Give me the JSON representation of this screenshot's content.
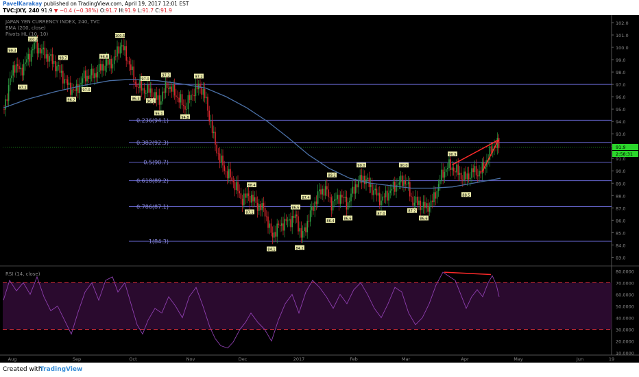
{
  "header": {
    "author": "PavelKarakay",
    "published": "published on TradingView.com, April 19, 2017 12:01 EST",
    "symbol": "TVC:JXY, 240",
    "last": "91.9",
    "change": "−0.4 (−0.38%)",
    "ohlc_o_label": "O:",
    "ohlc_o": "91.7",
    "ohlc_h_label": "H:",
    "ohlc_h": "91.9",
    "ohlc_l_label": "L:",
    "ohlc_l": "91.7",
    "ohlc_c_label": "C:",
    "ohlc_c": "91.9"
  },
  "footer": {
    "created": "Created with",
    "brand": "TradingView"
  },
  "colors": {
    "background": "#000000",
    "candle_up": "#2ea043",
    "candle_down": "#d9272e",
    "ema": "#4a6fa5",
    "fib": "#6a6ad6",
    "rsi_line": "#8e3fb0",
    "rsi_band": "#2a0a2e",
    "rsi_level": "#c62a3a",
    "trend": "#ff2a2a",
    "price_label": "#2bd62b"
  },
  "chart_data": {
    "type": "candlestick",
    "main_panel": {
      "legend": [
        "JAPAN YEN CURRENCY INDEX, 240, TVC",
        "EMA (200, close)",
        "Pivots HL (10, 10)"
      ],
      "y_ticks": [
        "102.0",
        "101.0",
        "100.0",
        "99.0",
        "98.0",
        "97.0",
        "96.0",
        "95.0",
        "94.0",
        "93.0",
        "92.0",
        "91.0",
        "90.0",
        "89.0",
        "88.0",
        "87.0",
        "86.0",
        "85.0",
        "84.0",
        "83.0"
      ],
      "ylim": [
        82.3,
        102.5
      ],
      "current_price": "91.9",
      "current_label2": "2:58:31",
      "fib_levels": [
        {
          "label": "",
          "value": 97.0
        },
        {
          "label": "0.236(94.1)",
          "value": 94.1
        },
        {
          "label": "0.382(92.3)",
          "value": 92.3
        },
        {
          "label": "0.5(90.7)",
          "value": 90.7
        },
        {
          "label": "0.618(89.2)",
          "value": 89.2
        },
        {
          "label": "0.786(87.1)",
          "value": 87.1
        },
        {
          "label": "1(84.3)",
          "value": 84.3
        }
      ],
      "pivot_labels": [
        {
          "t": 18,
          "text": "99.3",
          "v": 99.3,
          "pos": "above"
        },
        {
          "t": 33,
          "text": "97.2",
          "v": 97.2,
          "pos": "below"
        },
        {
          "t": 48,
          "text": "100.2",
          "v": 100.2,
          "pos": "above"
        },
        {
          "t": 92,
          "text": "98.7",
          "v": 98.7,
          "pos": "above"
        },
        {
          "t": 104,
          "text": "96.2",
          "v": 96.2,
          "pos": "below"
        },
        {
          "t": 126,
          "text": "97.0",
          "v": 97.0,
          "pos": "below"
        },
        {
          "t": 152,
          "text": "98.8",
          "v": 98.8,
          "pos": "above"
        },
        {
          "t": 175,
          "text": "100.5",
          "v": 100.5,
          "pos": "above"
        },
        {
          "t": 198,
          "text": "96.3",
          "v": 96.3,
          "pos": "below"
        },
        {
          "t": 212,
          "text": "97.0",
          "v": 97.0,
          "pos": "above"
        },
        {
          "t": 220,
          "text": "96.1",
          "v": 96.1,
          "pos": "below"
        },
        {
          "t": 232,
          "text": "95.1",
          "v": 95.1,
          "pos": "below"
        },
        {
          "t": 242,
          "text": "97.3",
          "v": 97.3,
          "pos": "above"
        },
        {
          "t": 270,
          "text": "94.8",
          "v": 94.8,
          "pos": "below"
        },
        {
          "t": 290,
          "text": "97.2",
          "v": 97.2,
          "pos": "above"
        },
        {
          "t": 367,
          "text": "88.4",
          "v": 88.4,
          "pos": "above"
        },
        {
          "t": 364,
          "text": "87.1",
          "v": 87.1,
          "pos": "below"
        },
        {
          "t": 396,
          "text": "84.1",
          "v": 84.1,
          "pos": "below"
        },
        {
          "t": 431,
          "text": "86.6",
          "v": 86.6,
          "pos": "above"
        },
        {
          "t": 437,
          "text": "84.2",
          "v": 84.2,
          "pos": "below"
        },
        {
          "t": 446,
          "text": "87.4",
          "v": 87.4,
          "pos": "above"
        },
        {
          "t": 482,
          "text": "86.4",
          "v": 86.4,
          "pos": "below"
        },
        {
          "t": 484,
          "text": "89.2",
          "v": 89.2,
          "pos": "above"
        },
        {
          "t": 507,
          "text": "86.6",
          "v": 86.6,
          "pos": "below"
        },
        {
          "t": 527,
          "text": "90.0",
          "v": 90.0,
          "pos": "above"
        },
        {
          "t": 556,
          "text": "87.0",
          "v": 87.0,
          "pos": "below"
        },
        {
          "t": 589,
          "text": "90.0",
          "v": 90.0,
          "pos": "above"
        },
        {
          "t": 601,
          "text": "87.2",
          "v": 87.2,
          "pos": "below"
        },
        {
          "t": 618,
          "text": "86.6",
          "v": 86.6,
          "pos": "below"
        },
        {
          "t": 660,
          "text": "90.9",
          "v": 90.9,
          "pos": "above"
        },
        {
          "t": 680,
          "text": "88.5",
          "v": 88.5,
          "pos": "below"
        }
      ],
      "wedge": {
        "t1": 660,
        "v1": 90.5,
        "t2": 727,
        "v2": 92.5,
        "t3": 703,
        "v3": 89.9
      }
    },
    "rsi_panel": {
      "legend": "RSI (14, close)",
      "y_ticks": [
        "80.0000",
        "70.0000",
        "60.0000",
        "50.0000",
        "40.0000",
        "30.0000",
        "20.0000",
        "10.0000"
      ],
      "ylim": [
        8,
        82
      ],
      "levels": [
        70,
        30
      ],
      "divergence": {
        "t1": 648,
        "v1": 79,
        "t2": 716,
        "v2": 77
      }
    },
    "x_ticks": [
      "Aug",
      "Sep",
      "Oct",
      "Nov",
      "Dec",
      "2017",
      "Feb",
      "Mar",
      "Apr",
      "May",
      "Jun",
      "19"
    ],
    "price_series": [
      {
        "t": 5,
        "v": 95.0
      },
      {
        "t": 12,
        "v": 96.5
      },
      {
        "t": 20,
        "v": 98.6
      },
      {
        "t": 30,
        "v": 98.1
      },
      {
        "t": 40,
        "v": 99.0
      },
      {
        "t": 50,
        "v": 100.2
      },
      {
        "t": 62,
        "v": 99.6
      },
      {
        "t": 75,
        "v": 99.0
      },
      {
        "t": 88,
        "v": 98.0
      },
      {
        "t": 100,
        "v": 96.8
      },
      {
        "t": 110,
        "v": 96.4
      },
      {
        "t": 122,
        "v": 97.6
      },
      {
        "t": 138,
        "v": 97.8
      },
      {
        "t": 152,
        "v": 98.6
      },
      {
        "t": 165,
        "v": 98.8
      },
      {
        "t": 176,
        "v": 100.3
      },
      {
        "t": 188,
        "v": 98.8
      },
      {
        "t": 197,
        "v": 97.1
      },
      {
        "t": 208,
        "v": 96.6
      },
      {
        "t": 220,
        "v": 96.4
      },
      {
        "t": 232,
        "v": 95.6
      },
      {
        "t": 244,
        "v": 97.0
      },
      {
        "t": 256,
        "v": 96.2
      },
      {
        "t": 270,
        "v": 95.1
      },
      {
        "t": 282,
        "v": 96.4
      },
      {
        "t": 292,
        "v": 96.9
      },
      {
        "t": 300,
        "v": 95.8
      },
      {
        "t": 306,
        "v": 94.2
      },
      {
        "t": 312,
        "v": 92.6
      },
      {
        "t": 320,
        "v": 91.0
      },
      {
        "t": 330,
        "v": 89.9
      },
      {
        "t": 342,
        "v": 89.0
      },
      {
        "t": 352,
        "v": 87.7
      },
      {
        "t": 364,
        "v": 88.0
      },
      {
        "t": 374,
        "v": 87.3
      },
      {
        "t": 386,
        "v": 86.8
      },
      {
        "t": 396,
        "v": 84.7
      },
      {
        "t": 408,
        "v": 85.6
      },
      {
        "t": 420,
        "v": 85.9
      },
      {
        "t": 432,
        "v": 86.3
      },
      {
        "t": 440,
        "v": 84.6
      },
      {
        "t": 452,
        "v": 86.4
      },
      {
        "t": 464,
        "v": 88.1
      },
      {
        "t": 474,
        "v": 88.6
      },
      {
        "t": 484,
        "v": 87.3
      },
      {
        "t": 496,
        "v": 88.0
      },
      {
        "t": 507,
        "v": 87.3
      },
      {
        "t": 518,
        "v": 88.8
      },
      {
        "t": 530,
        "v": 89.5
      },
      {
        "t": 542,
        "v": 88.6
      },
      {
        "t": 556,
        "v": 87.6
      },
      {
        "t": 568,
        "v": 88.3
      },
      {
        "t": 580,
        "v": 89.0
      },
      {
        "t": 592,
        "v": 89.2
      },
      {
        "t": 601,
        "v": 87.6
      },
      {
        "t": 612,
        "v": 87.3
      },
      {
        "t": 622,
        "v": 87.0
      },
      {
        "t": 632,
        "v": 87.6
      },
      {
        "t": 642,
        "v": 89.3
      },
      {
        "t": 652,
        "v": 90.4
      },
      {
        "t": 662,
        "v": 90.2
      },
      {
        "t": 672,
        "v": 89.6
      },
      {
        "t": 680,
        "v": 89.4
      },
      {
        "t": 690,
        "v": 90.0
      },
      {
        "t": 700,
        "v": 89.8
      },
      {
        "t": 710,
        "v": 90.8
      },
      {
        "t": 718,
        "v": 91.9
      },
      {
        "t": 724,
        "v": 92.2
      },
      {
        "t": 728,
        "v": 91.9
      }
    ],
    "ema_series": [
      {
        "t": 5,
        "v": 95.1
      },
      {
        "t": 40,
        "v": 95.8
      },
      {
        "t": 80,
        "v": 96.4
      },
      {
        "t": 120,
        "v": 96.9
      },
      {
        "t": 160,
        "v": 97.3
      },
      {
        "t": 190,
        "v": 97.4
      },
      {
        "t": 230,
        "v": 97.3
      },
      {
        "t": 270,
        "v": 97.0
      },
      {
        "t": 300,
        "v": 96.7
      },
      {
        "t": 330,
        "v": 96.0
      },
      {
        "t": 360,
        "v": 95.1
      },
      {
        "t": 390,
        "v": 94.0
      },
      {
        "t": 420,
        "v": 92.7
      },
      {
        "t": 450,
        "v": 91.3
      },
      {
        "t": 480,
        "v": 90.2
      },
      {
        "t": 510,
        "v": 89.4
      },
      {
        "t": 540,
        "v": 89.0
      },
      {
        "t": 570,
        "v": 88.8
      },
      {
        "t": 600,
        "v": 88.6
      },
      {
        "t": 630,
        "v": 88.6
      },
      {
        "t": 660,
        "v": 88.7
      },
      {
        "t": 690,
        "v": 89.0
      },
      {
        "t": 720,
        "v": 89.3
      },
      {
        "t": 730,
        "v": 89.4
      }
    ],
    "rsi_series": [
      {
        "t": 5,
        "v": 55
      },
      {
        "t": 14,
        "v": 72
      },
      {
        "t": 24,
        "v": 63
      },
      {
        "t": 34,
        "v": 70
      },
      {
        "t": 44,
        "v": 60
      },
      {
        "t": 54,
        "v": 75
      },
      {
        "t": 64,
        "v": 58
      },
      {
        "t": 74,
        "v": 46
      },
      {
        "t": 84,
        "v": 50
      },
      {
        "t": 94,
        "v": 38
      },
      {
        "t": 104,
        "v": 26
      },
      {
        "t": 114,
        "v": 45
      },
      {
        "t": 124,
        "v": 62
      },
      {
        "t": 134,
        "v": 70
      },
      {
        "t": 144,
        "v": 55
      },
      {
        "t": 154,
        "v": 72
      },
      {
        "t": 164,
        "v": 75
      },
      {
        "t": 172,
        "v": 62
      },
      {
        "t": 182,
        "v": 70
      },
      {
        "t": 192,
        "v": 50
      },
      {
        "t": 200,
        "v": 34
      },
      {
        "t": 208,
        "v": 26
      },
      {
        "t": 216,
        "v": 38
      },
      {
        "t": 226,
        "v": 48
      },
      {
        "t": 236,
        "v": 44
      },
      {
        "t": 246,
        "v": 58
      },
      {
        "t": 256,
        "v": 50
      },
      {
        "t": 266,
        "v": 40
      },
      {
        "t": 276,
        "v": 58
      },
      {
        "t": 286,
        "v": 66
      },
      {
        "t": 296,
        "v": 50
      },
      {
        "t": 306,
        "v": 32
      },
      {
        "t": 314,
        "v": 22
      },
      {
        "t": 322,
        "v": 16
      },
      {
        "t": 332,
        "v": 14
      },
      {
        "t": 340,
        "v": 19
      },
      {
        "t": 350,
        "v": 30
      },
      {
        "t": 358,
        "v": 36
      },
      {
        "t": 366,
        "v": 44
      },
      {
        "t": 376,
        "v": 36
      },
      {
        "t": 386,
        "v": 30
      },
      {
        "t": 396,
        "v": 20
      },
      {
        "t": 406,
        "v": 38
      },
      {
        "t": 416,
        "v": 52
      },
      {
        "t": 426,
        "v": 60
      },
      {
        "t": 436,
        "v": 44
      },
      {
        "t": 446,
        "v": 62
      },
      {
        "t": 456,
        "v": 72
      },
      {
        "t": 466,
        "v": 66
      },
      {
        "t": 476,
        "v": 58
      },
      {
        "t": 486,
        "v": 48
      },
      {
        "t": 496,
        "v": 60
      },
      {
        "t": 506,
        "v": 52
      },
      {
        "t": 516,
        "v": 64
      },
      {
        "t": 526,
        "v": 70
      },
      {
        "t": 536,
        "v": 60
      },
      {
        "t": 546,
        "v": 48
      },
      {
        "t": 556,
        "v": 40
      },
      {
        "t": 566,
        "v": 52
      },
      {
        "t": 576,
        "v": 66
      },
      {
        "t": 586,
        "v": 62
      },
      {
        "t": 596,
        "v": 44
      },
      {
        "t": 606,
        "v": 34
      },
      {
        "t": 616,
        "v": 40
      },
      {
        "t": 626,
        "v": 52
      },
      {
        "t": 636,
        "v": 68
      },
      {
        "t": 646,
        "v": 79
      },
      {
        "t": 656,
        "v": 75
      },
      {
        "t": 664,
        "v": 72
      },
      {
        "t": 672,
        "v": 60
      },
      {
        "t": 680,
        "v": 48
      },
      {
        "t": 688,
        "v": 58
      },
      {
        "t": 696,
        "v": 64
      },
      {
        "t": 704,
        "v": 58
      },
      {
        "t": 712,
        "v": 70
      },
      {
        "t": 718,
        "v": 76
      },
      {
        "t": 724,
        "v": 68
      },
      {
        "t": 728,
        "v": 58
      }
    ]
  }
}
